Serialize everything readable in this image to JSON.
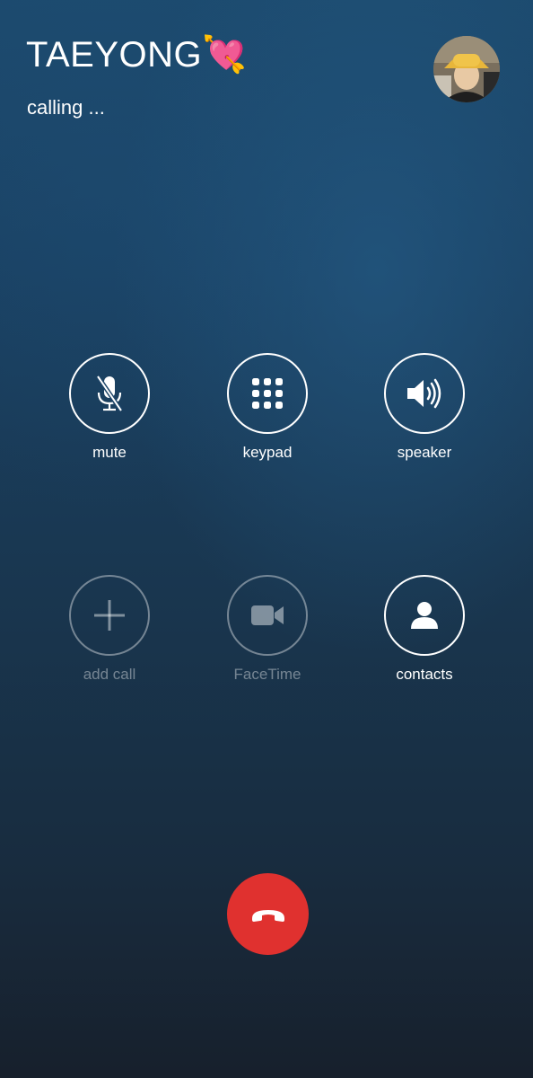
{
  "call": {
    "contact_name": "TAEYONG💘",
    "status": "calling ..."
  },
  "controls": [
    {
      "id": "mute",
      "label": "mute",
      "icon": "mic-off-icon",
      "enabled": true
    },
    {
      "id": "keypad",
      "label": "keypad",
      "icon": "keypad-icon",
      "enabled": true
    },
    {
      "id": "speaker",
      "label": "speaker",
      "icon": "speaker-icon",
      "enabled": true
    },
    {
      "id": "add-call",
      "label": "add call",
      "icon": "plus-icon",
      "enabled": false
    },
    {
      "id": "facetime",
      "label": "FaceTime",
      "icon": "video-camera-icon",
      "enabled": false
    },
    {
      "id": "contacts",
      "label": "contacts",
      "icon": "person-icon",
      "enabled": true
    }
  ],
  "end_call": {
    "icon": "phone-hangup-icon",
    "color": "#e0312f"
  },
  "colors": {
    "background_top": "#1c4a6e",
    "background_bottom": "#17202c",
    "text": "#ffffff",
    "disabled_text": "rgba(255,255,255,0.4)"
  }
}
